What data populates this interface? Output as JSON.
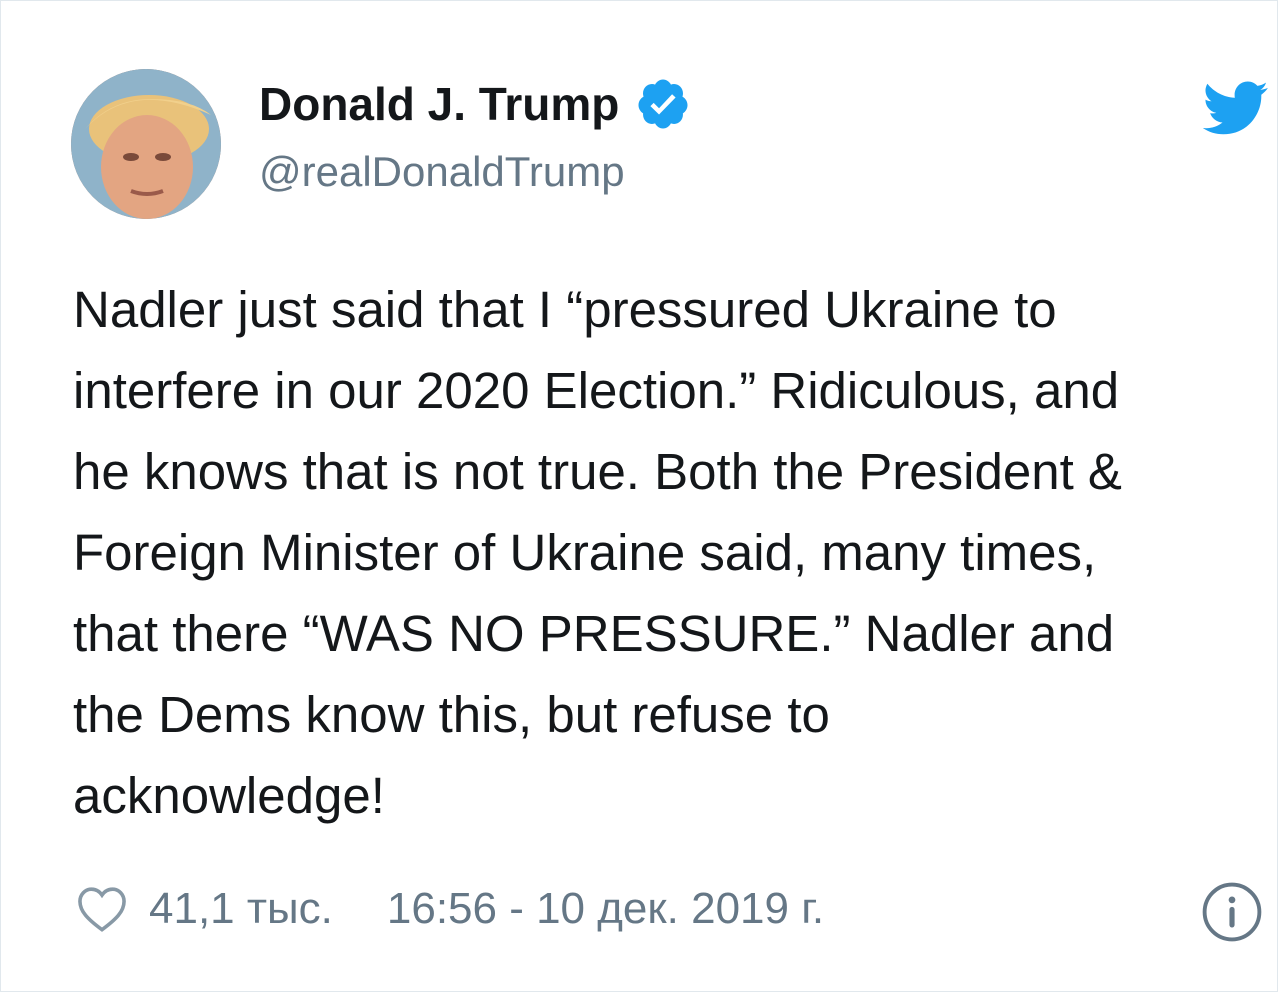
{
  "author": {
    "display_name": "Donald J. Trump",
    "handle": "@realDonaldTrump",
    "verified": true
  },
  "tweet": {
    "lines": [
      "Nadler just said that I “pressured Ukraine to",
      "interfere in our 2020 Election.” Ridiculous, and",
      "he knows that is not true. Both the President &",
      "Foreign Minister of Ukraine said, many times,",
      "that there “WAS NO PRESSURE.” Nadler and",
      "the Dems know this, but refuse to",
      "acknowledge!"
    ]
  },
  "footer": {
    "likes": "41,1 тыс.",
    "timestamp": "16:56 - 10 дек. 2019 г."
  },
  "icons": {
    "brand": "twitter-bird-icon",
    "verified": "verified-badge-icon",
    "like": "heart-icon",
    "info": "info-icon"
  },
  "colors": {
    "twitter_blue": "#1da1f2",
    "text_primary": "#14171a",
    "text_secondary": "#657786"
  }
}
